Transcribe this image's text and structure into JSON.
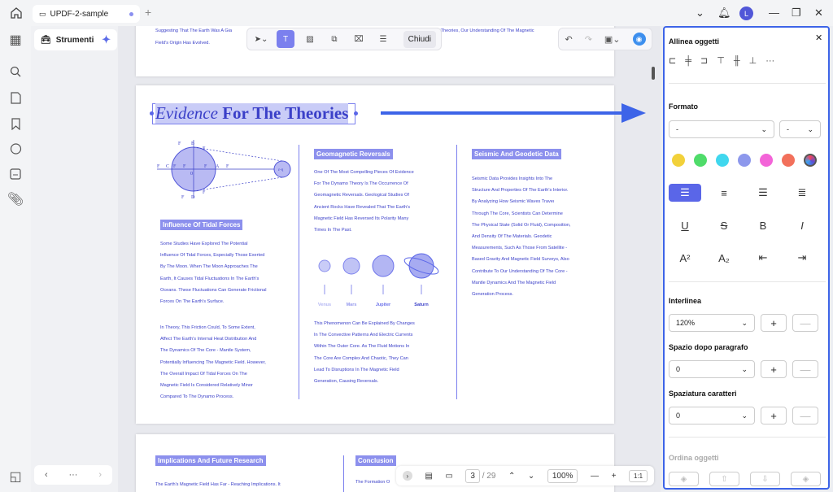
{
  "tab": {
    "title": "UPDF-2-sample"
  },
  "user": {
    "initial": "L"
  },
  "sidebar": {
    "strumenti": "Strumenti"
  },
  "toolbar": {
    "close": "Chiudi"
  },
  "page_top": {
    "line1": "Suggesting That The Earth Was A Gia",
    "line1b": "d Theories, Our Understanding Of The Magnetic",
    "line2": "Field's Origin Has Evolved."
  },
  "page": {
    "title_italic": "Evidence",
    "title_rest": " For The Theories",
    "diagram_labels": {
      "F1": "F",
      "B": "B",
      "Fb": "F",
      "Fd": "F",
      "Fc": "F",
      "C": "C",
      "Fa": "F",
      "Fq": "F",
      "O": "0",
      "A": "A",
      "Fr": "F",
      "Fs": "F",
      "D": "D",
      "Ft": "F",
      "Fe": "F",
      "earth": "ε-η"
    },
    "col1": {
      "head": "Influence Of Tidal Forces",
      "p1": [
        "Some Studies Have Explored The Potential",
        "Influence Of Tidal Forces, Especially Those Exerted",
        "By The Moon. When The Moon Approaches The",
        "Earth, It Causes Tidal Fluctuations In The Earth's",
        "Oceans. These Fluctuations Can Generate Frictional",
        "Forces On The Earth's Surface."
      ],
      "p2": [
        " In Theory, This Friction Could, To Some Extent,",
        "Affect The Earth's Internal Heat Distribution And",
        "The Dynamics Of The Core - Mantle System,",
        "Potentially Influencing The Magnetic Field. However,",
        "The Overall Impact Of Tidal Forces On The",
        "Magnetic Field Is Considered Relatively Minor",
        "Compared To The Dynamo Process."
      ]
    },
    "col2": {
      "head": "Geomagnetic Reversals",
      "p1": [
        "One Of The Most Compelling Pieces Of Evidence",
        "For The Dynamo Theory Is The Occurrence Of",
        "Geomagnetic Reversals. Geological Studies Of",
        "Ancient Rocks Have Revealed That The Earth's",
        "Magnetic Field Has Reversed Its Polarity Many",
        "Times In The Past."
      ],
      "planets": [
        "Venus",
        "Mars",
        "Jupiter",
        "Saturn"
      ],
      "p2": [
        "This Phenomenon Can Be Explained By Changes",
        "In The Convective Patterns And Electric Currents",
        "Within The Outer Core. As The Fluid Motions In",
        "The Core Are Complex And Chaotic, They Can",
        "Lead To Disruptions In The Magnetic Field",
        "Generation, Causing Reversals."
      ]
    },
    "col3": {
      "head": "Seismic And Geodetic Data",
      "p1": [
        "Seismic Data Provides Insights Into The",
        "Structure And Properties Of The Earth's Interior.",
        "By Analyzing How Seismic Waves Traveı",
        "Through The Core, Scientists Can Determine",
        "The Physical State (Solid Or Fluid), Composition,",
        "And Density Of The Materials. Geodetic",
        "Measurements, Such As Those From Satellite -",
        "Based Gravity And Magnetic Field Surveys, Also",
        "Contribute To Our Understanding Of The Core -",
        "Mantle Dynamics And The Magnetic Field",
        "Generation Process."
      ]
    }
  },
  "page_next": {
    "head1": "Implications And Future Research",
    "head2": "Conclusion",
    "line1": "The Earth's Magnetic Field Has Far - Reaching Implications. It",
    "line2": "The Formation O"
  },
  "bottom": {
    "page": "3",
    "total": "/ 29",
    "zoom": "100%"
  },
  "panel": {
    "align_title": "Allinea oggetti",
    "format_title": "Formato",
    "font_select": "-",
    "size_select": "-",
    "colors": [
      "#f2d13a",
      "#4fdc6a",
      "#40d7ee",
      "#8d98ec",
      "#f364d8",
      "#f2705b",
      "#5a4fd6"
    ],
    "superscript": "A²",
    "subscript": "A₂",
    "underline": "U",
    "strike": "S",
    "bold": "B",
    "italic": "I",
    "line_spacing_title": "Interlinea",
    "line_spacing": "120%",
    "para_title": "Spazio dopo paragrafo",
    "para": "0",
    "char_title": "Spaziatura caratteri",
    "char": "0",
    "order_title": "Ordina oggetti"
  }
}
